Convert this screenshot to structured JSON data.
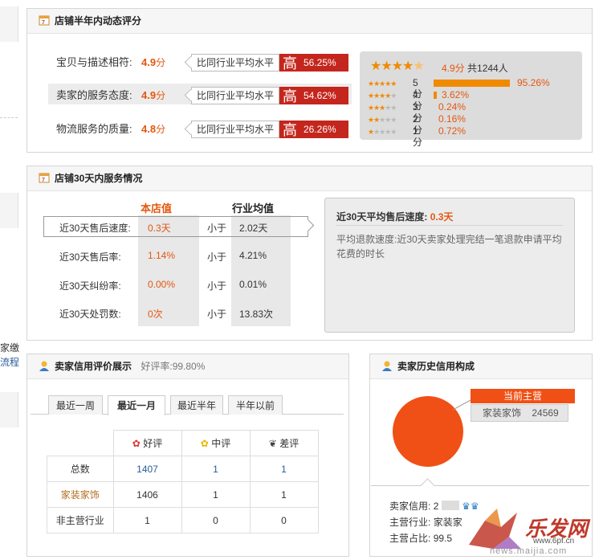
{
  "panel1": {
    "title": "店铺半年内动态评分",
    "rows": [
      {
        "label": "宝贝与描述相符:",
        "score": "4.9",
        "unit": "分",
        "compare": "比同行业平均水平",
        "level": "高",
        "pct": "56.25%"
      },
      {
        "label": "卖家的服务态度:",
        "score": "4.9",
        "unit": "分",
        "compare": "比同行业平均水平",
        "level": "高",
        "pct": "54.62%"
      },
      {
        "label": "物流服务的质量:",
        "score": "4.8",
        "unit": "分",
        "compare": "比同行业平均水平",
        "level": "高",
        "pct": "26.26%"
      }
    ],
    "summary": {
      "score": "4.9分",
      "total": "共1244人",
      "stars_value": 4.5
    },
    "distribution": [
      {
        "label": "5分",
        "pct": "95.26%",
        "fraction": 0.9526
      },
      {
        "label": "4分",
        "pct": "3.62%",
        "fraction": 0.0362
      },
      {
        "label": "3分",
        "pct": "0.24%",
        "fraction": 0.0024
      },
      {
        "label": "2分",
        "pct": "0.16%",
        "fraction": 0.0016
      },
      {
        "label": "1分",
        "pct": "0.72%",
        "fraction": 0.0072
      }
    ]
  },
  "panel2": {
    "title": "店铺30天内服务情况",
    "col_store": "本店值",
    "col_industry": "行业均值",
    "rows": [
      {
        "label": "近30天售后速度:",
        "store": "0.3天",
        "cmp": "小于",
        "industry": "2.02天"
      },
      {
        "label": "近30天售后率:",
        "store": "1.14%",
        "cmp": "小于",
        "industry": "4.21%"
      },
      {
        "label": "近30天纠纷率:",
        "store": "0.00%",
        "cmp": "小于",
        "industry": "0.01%"
      },
      {
        "label": "近30天处罚数:",
        "store": "0次",
        "cmp": "小于",
        "industry": "13.83次"
      }
    ],
    "info": {
      "title": "近30天平均售后速度:",
      "value": "0.3天",
      "desc": "平均退款速度:近30天卖家处理完结一笔退款申请平均花费的时长"
    }
  },
  "panel3": {
    "title": "卖家信用评价展示",
    "rate_label": "好评率:",
    "rate": "99.80%",
    "tabs": [
      "最近一周",
      "最近一月",
      "最近半年",
      "半年以前"
    ],
    "active_tab": 1,
    "headers": {
      "good": "好评",
      "neutral": "中评",
      "bad": "差评"
    },
    "rows": [
      {
        "label": "总数",
        "good": "1407",
        "neutral": "1",
        "bad": "1"
      },
      {
        "label": "家装家饰",
        "good": "1406",
        "neutral": "1",
        "bad": "1"
      },
      {
        "label": "非主营行业",
        "good": "1",
        "neutral": "0",
        "bad": "0"
      }
    ]
  },
  "panel4": {
    "title": "卖家历史信用构成",
    "flag": "当前主营",
    "category": "家装家饰",
    "category_count": "24569",
    "credit_label": "卖家信用:",
    "credit_value": "2",
    "industry_label": "主营行业:",
    "industry_value": "家装家",
    "share_label": "主营占比:",
    "share_value": "99.5"
  },
  "left_fragments": {
    "a": "家缴",
    "b": "流程"
  },
  "watermark": {
    "brand": "乐发网",
    "site": "www.6pf.cn",
    "url": "news.maijia.com"
  },
  "colors": {
    "accent": "#e4570f",
    "high": "#c4261d",
    "star": "#f08a00",
    "pie": "#f05015"
  }
}
